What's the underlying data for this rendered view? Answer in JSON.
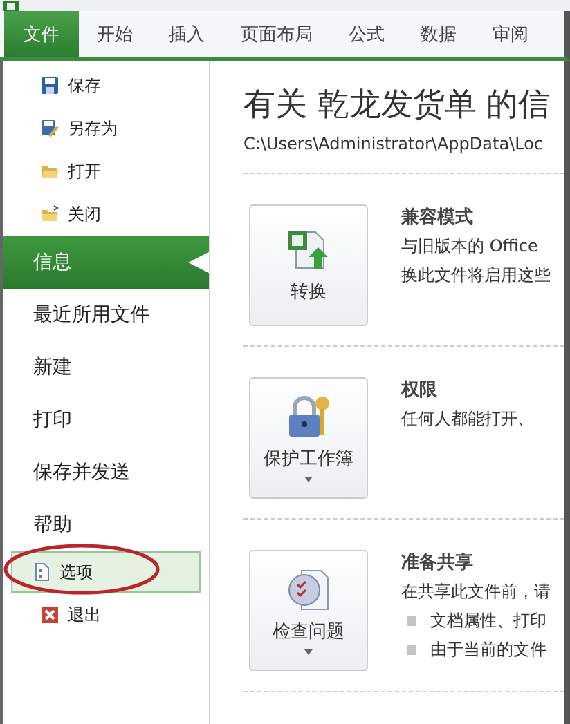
{
  "ribbon_tabs": [
    {
      "label": "文件",
      "selected": true
    },
    {
      "label": "开始",
      "selected": false
    },
    {
      "label": "插入",
      "selected": false
    },
    {
      "label": "页面布局",
      "selected": false
    },
    {
      "label": "公式",
      "selected": false
    },
    {
      "label": "数据",
      "selected": false
    },
    {
      "label": "审阅",
      "selected": false
    }
  ],
  "sidebar": {
    "items": [
      {
        "kind": "command",
        "label": "保存",
        "selected": false,
        "highlighted": false
      },
      {
        "kind": "command",
        "label": "另存为",
        "selected": false,
        "highlighted": false
      },
      {
        "kind": "command",
        "label": "打开",
        "selected": false,
        "highlighted": false
      },
      {
        "kind": "command",
        "label": "关闭",
        "selected": false,
        "highlighted": false
      },
      {
        "kind": "page",
        "label": "信息",
        "selected": true,
        "highlighted": false
      },
      {
        "kind": "page",
        "label": "最近所用文件",
        "selected": false,
        "highlighted": false
      },
      {
        "kind": "page",
        "label": "新建",
        "selected": false,
        "highlighted": false
      },
      {
        "kind": "page",
        "label": "打印",
        "selected": false,
        "highlighted": false
      },
      {
        "kind": "page",
        "label": "保存并发送",
        "selected": false,
        "highlighted": false
      },
      {
        "kind": "page",
        "label": "帮助",
        "selected": false,
        "highlighted": false
      },
      {
        "kind": "command",
        "label": "选项",
        "selected": false,
        "highlighted": true
      },
      {
        "kind": "command",
        "label": "退出",
        "selected": false,
        "highlighted": false
      }
    ]
  },
  "info": {
    "title": "有关 乾龙发货单 的信",
    "path": "C:\\Users\\Administrator\\AppData\\Loc",
    "sections": [
      {
        "button": "转换",
        "dropdown": false,
        "heading": "兼容模式",
        "lines": [
          "与旧版本的 Office",
          "换此文件将启用这些"
        ]
      },
      {
        "button": "保护工作簿",
        "dropdown": true,
        "heading": "权限",
        "lines": [
          "任何人都能打开、"
        ]
      },
      {
        "button": "检查问题",
        "dropdown": true,
        "heading": "准备共享",
        "lines": [
          "在共享此文件前，请"
        ],
        "bullets": [
          "文档属性、打印",
          "由于当前的文件"
        ]
      }
    ]
  }
}
